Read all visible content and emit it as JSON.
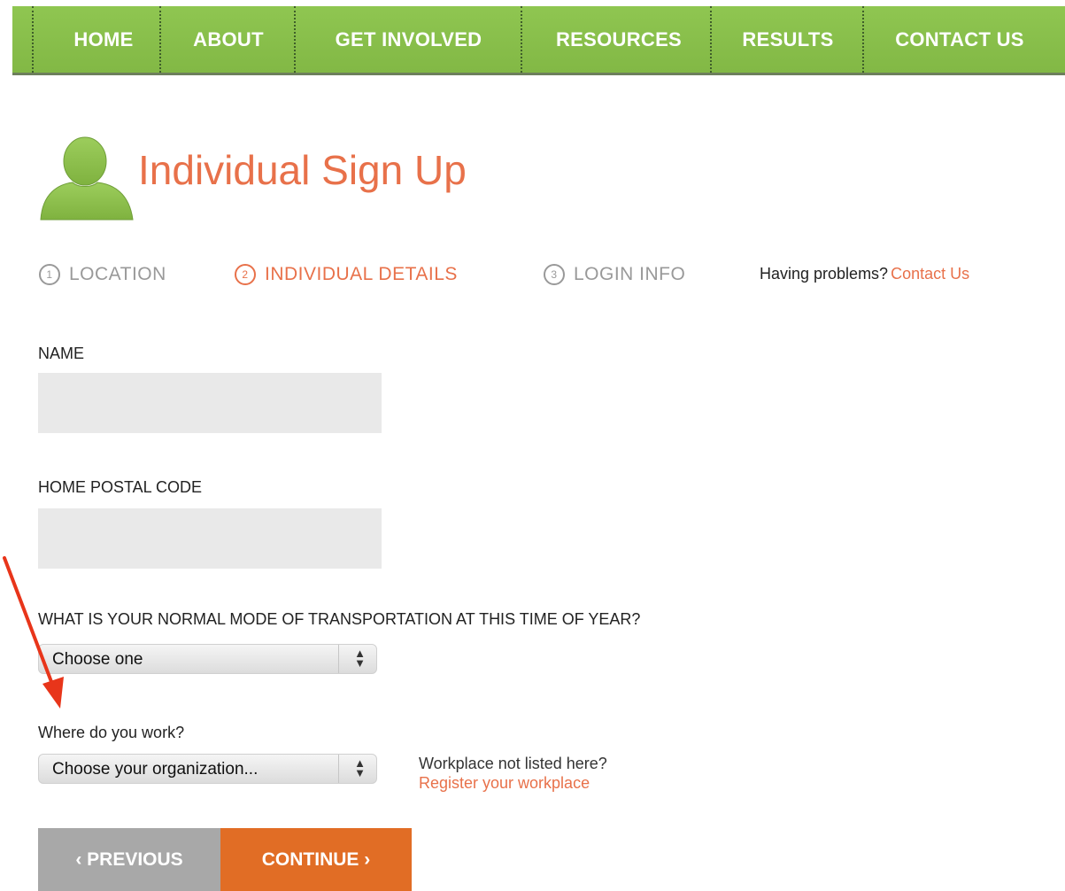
{
  "nav": {
    "items": [
      "HOME",
      "ABOUT",
      "GET INVOLVED",
      "RESOURCES",
      "RESULTS",
      "CONTACT US"
    ]
  },
  "page": {
    "title": "Individual Sign Up",
    "avatar_icon": "user-silhouette-icon"
  },
  "steps": [
    {
      "num": "1",
      "label": "LOCATION",
      "state": "inactive"
    },
    {
      "num": "2",
      "label": "INDIVIDUAL DETAILS",
      "state": "active"
    },
    {
      "num": "3",
      "label": "LOGIN INFO",
      "state": "inactive"
    }
  ],
  "help": {
    "text": "Having problems?",
    "link": "Contact Us"
  },
  "form": {
    "name_label": "NAME",
    "name_value": "",
    "postal_label": "HOME POSTAL CODE",
    "postal_value": "",
    "transport_label": "WHAT IS YOUR NORMAL MODE OF TRANSPORTATION AT THIS TIME OF YEAR?",
    "transport_selected": "Choose one",
    "work_label": "Where do you work?",
    "work_selected": "Choose your organization...",
    "workplace_note": "Workplace not listed here?",
    "workplace_link": "Register your workplace"
  },
  "buttons": {
    "previous": "‹ PREVIOUS",
    "continue": "CONTINUE ›"
  },
  "colors": {
    "nav_green": "#8bc34a",
    "accent_orange": "#e8714a",
    "continue_orange": "#e16d25",
    "annotation_red": "#e8351a"
  }
}
